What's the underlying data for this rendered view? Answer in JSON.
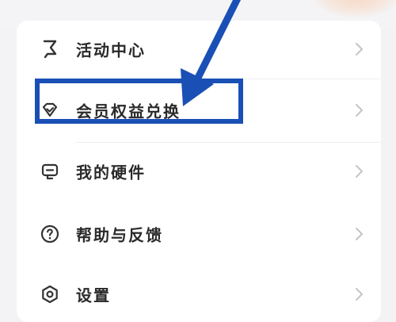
{
  "menu": {
    "items": [
      {
        "label": "活动中心",
        "icon": "flag-icon"
      },
      {
        "label": "会员权益兑换",
        "icon": "diamond-check-icon"
      },
      {
        "label": "我的硬件",
        "icon": "device-icon"
      },
      {
        "label": "帮助与反馈",
        "icon": "question-circle-icon"
      },
      {
        "label": "设置",
        "icon": "settings-hex-icon"
      }
    ]
  },
  "annotation": {
    "highlight_color": "#1a4fb5",
    "arrow_color": "#1a4fb5"
  },
  "colors": {
    "card_background": "#ffffff",
    "page_background": "#f3f3f5",
    "label_color": "#2a2a2a",
    "icon_color": "#333333",
    "chevron_color": "#c4c4c4",
    "accent": "#f7d9c4"
  }
}
